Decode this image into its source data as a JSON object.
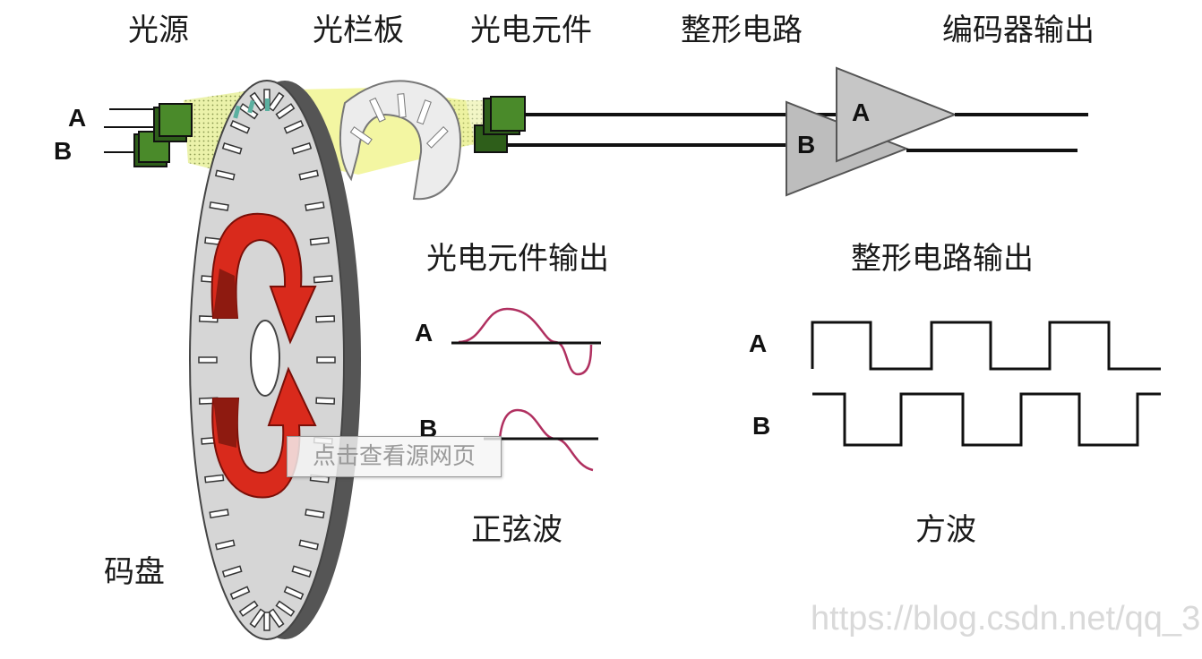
{
  "labels": {
    "light_source": "光源",
    "grating": "光栏板",
    "photo_element": "光电元件",
    "shaping_circuit": "整形电路",
    "encoder_output": "编码器输出",
    "photo_output": "光电元件输出",
    "shaping_output": "整形电路输出",
    "sine_wave": "正弦波",
    "square_wave": "方波",
    "code_disk": "码盘"
  },
  "channels": {
    "a": "A",
    "b": "B"
  },
  "overlay_button": "点击查看源网页",
  "watermark": "https://blog.csdn.net/qq_3",
  "colors": {
    "sensor_green": "#4a8a2a",
    "beam_yellow": "#e6ee8a",
    "disk_gray": "#d4d4d4",
    "arrow_red": "#d92a1c",
    "amp_gray": "#bdbdbd",
    "sine_red": "#b03060"
  }
}
